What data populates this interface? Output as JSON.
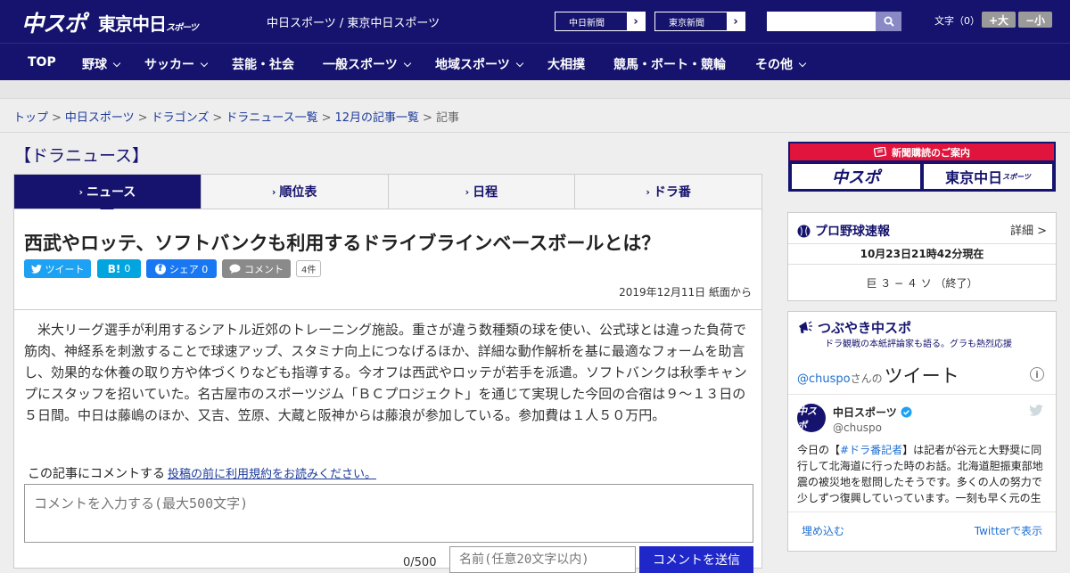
{
  "header": {
    "logo_chuspo": "中スポ",
    "logo_tokyo": "東京中日",
    "logo_tokyo_small": "スポーツ",
    "site_title": "中日スポーツ / 東京中日スポーツ",
    "links": [
      {
        "label": "中日新聞"
      },
      {
        "label": "東京新聞"
      }
    ],
    "search_placeholder": "",
    "fontsize_label": "文字（0）",
    "font_larger": "+大",
    "font_smaller": "−小"
  },
  "nav": {
    "items": [
      {
        "label": "TOP",
        "dropdown": false
      },
      {
        "label": "野球",
        "dropdown": true
      },
      {
        "label": "サッカー",
        "dropdown": true
      },
      {
        "label": "芸能・社会",
        "dropdown": false
      },
      {
        "label": "一般スポーツ",
        "dropdown": true
      },
      {
        "label": "地域スポーツ",
        "dropdown": true
      },
      {
        "label": "大相撲",
        "dropdown": false
      },
      {
        "label": "競馬・ボート・競輪",
        "dropdown": false
      },
      {
        "label": "その他",
        "dropdown": true
      }
    ]
  },
  "breadcrumb": {
    "items": [
      {
        "label": "トップ"
      },
      {
        "label": "中日スポーツ"
      },
      {
        "label": "ドラゴンズ"
      },
      {
        "label": "ドラニュース一覧"
      },
      {
        "label": "12月の記事一覧"
      }
    ],
    "current": "記事",
    "separator": ">"
  },
  "section_title": "【ドラニュース】",
  "tabs": [
    {
      "label": "ニュース",
      "active": true
    },
    {
      "label": "順位表",
      "active": false
    },
    {
      "label": "日程",
      "active": false
    },
    {
      "label": "ドラ番",
      "active": false
    }
  ],
  "article": {
    "title": "西武やロッテ、ソフトバンクも利用するドライブラインベースボールとは？",
    "share": {
      "tweet": "ツイート",
      "hatena": "0",
      "fb_share": "シェア 0",
      "comment": "コメント",
      "comment_count": "4件"
    },
    "date": "2019年12月11日 紙面から",
    "body": "米大リーグ選手が利用するシアトル近郊のトレーニング施設。重さが違う数種類の球を使い、公式球とは違った負荷で筋肉、神経系を刺激することで球速アップ、スタミナ向上につなげるほか、詳細な動作解析を基に最適なフォームを助言し、効果的な休養の取り方や体づくりなども指導する。今オフは西武やロッテが若手を派遣。ソフトバンクは秋季キャンプにスタッフを招いていた。名古屋市のスポーツジム「ＢＣプロジェクト」を通じて実現した今回の合宿は９～１３日の５日間。中日は藤嶋のほか、又吉、笠原、大蔵と阪神からは藤浪が参加している。参加費は１人５０万円。"
  },
  "comment_form": {
    "label": "この記事にコメントする",
    "terms_link": "投稿の前に利用規約をお読みください。",
    "placeholder": "コメントを入力する(最大500文字)",
    "char_count": "0/500",
    "name_placeholder": "名前(任意20文字以内)",
    "submit": "コメントを送信"
  },
  "sidebar": {
    "banner": {
      "heading": "新聞購読のご案内",
      "logo_left": "中スポ",
      "logo_right": "東京中日",
      "logo_right_small": "スポーツ"
    },
    "baseball": {
      "title": "プロ野球速報",
      "detail": "詳細 >",
      "timestamp": "10月23日21時42分現在",
      "score": "巨 ３ − ４ ソ （終了）"
    },
    "twitter": {
      "title": "つぶやき中スポ",
      "subtitle": "ドラ観戦の本紙評論家も語る。グラも熱烈応援",
      "handle_link": "@chuspo",
      "handle_suffix": "さんの",
      "tweets_label": "ツイート",
      "account_name": "中日スポーツ",
      "account_handle": "@chuspo",
      "avatar_text": "中スポ",
      "text_pre": "今日の【",
      "text_hashtag": "#ドラ番記者",
      "text_post": "】は記者が谷元と大野奨に同行して北海道に行った時のお話。北海道胆振東部地震の被災地を慰問したそうです。多くの人の努力で少しずつ復興していっています。一刻も早く元の生",
      "embed": "埋め込む",
      "view_on_twitter": "Twitterで表示"
    }
  },
  "colors": {
    "brand_navy": "#15136d",
    "link_blue": "#1d3a9a",
    "twitter_blue": "#1da1f2",
    "facebook_blue": "#1877f2",
    "hatena_blue": "#00a4de",
    "banner_red": "#e0143c",
    "submit_blue": "#1f27c9"
  }
}
